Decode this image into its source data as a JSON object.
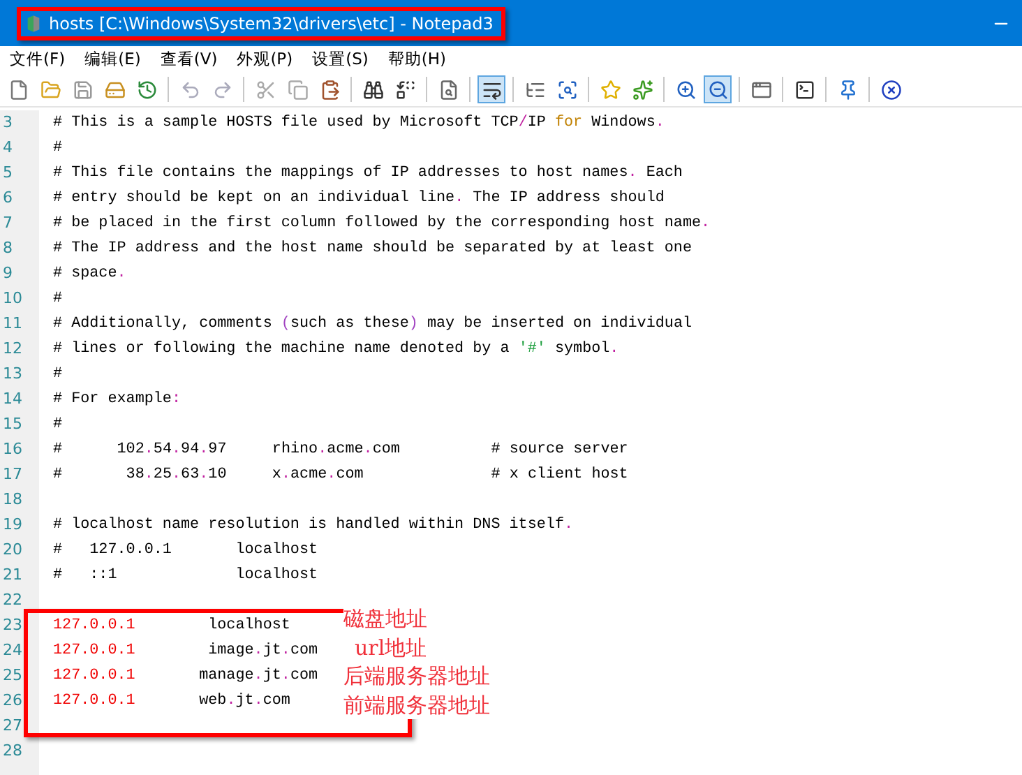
{
  "window": {
    "title": "hosts [C:\\Windows\\System32\\drivers\\etc] - Notepad3"
  },
  "menu": [
    "文件(F)",
    "编辑(E)",
    "查看(V)",
    "外观(P)",
    "设置(S)",
    "帮助(H)"
  ],
  "toolbar": [
    [
      {
        "kind": "new",
        "on": false
      },
      {
        "kind": "open",
        "on": false
      },
      {
        "kind": "save",
        "on": false
      },
      {
        "kind": "saveas",
        "on": false
      },
      {
        "kind": "revert",
        "on": false
      }
    ],
    [
      {
        "kind": "undo",
        "on": false
      },
      {
        "kind": "redo",
        "on": false
      }
    ],
    [
      {
        "kind": "cut",
        "on": false
      },
      {
        "kind": "copy",
        "on": false
      },
      {
        "kind": "paste",
        "on": false
      }
    ],
    [
      {
        "kind": "find",
        "on": false
      },
      {
        "kind": "replace",
        "on": false
      }
    ],
    [
      {
        "kind": "search",
        "on": false
      }
    ],
    [
      {
        "kind": "wrap",
        "on": true
      }
    ],
    [
      {
        "kind": "list",
        "on": false
      },
      {
        "kind": "target",
        "on": false
      }
    ],
    [
      {
        "kind": "star",
        "on": false
      },
      {
        "kind": "staradd",
        "on": false
      }
    ],
    [
      {
        "kind": "zoomin",
        "on": false
      },
      {
        "kind": "zoomout",
        "on": true
      }
    ],
    [
      {
        "kind": "window",
        "on": false
      }
    ],
    [
      {
        "kind": "terminal",
        "on": false
      }
    ],
    [
      {
        "kind": "pin",
        "on": false
      }
    ],
    [
      {
        "kind": "close",
        "on": false
      }
    ]
  ],
  "lines": [
    {
      "number": "3",
      "segments": [
        {
          "text": "# This is a sample HOSTS file used by Microsoft TCP",
          "kind": "plain"
        },
        {
          "text": "/",
          "kind": "punct"
        },
        {
          "text": "IP ",
          "kind": "plain"
        },
        {
          "text": "for",
          "kind": "keyword"
        },
        {
          "text": " Windows",
          "kind": "plain"
        },
        {
          "text": ".",
          "kind": "punct"
        }
      ]
    },
    {
      "number": "4",
      "segments": [
        {
          "text": "#",
          "kind": "plain"
        }
      ]
    },
    {
      "number": "5",
      "segments": [
        {
          "text": "# This file contains the mappings of IP addresses to host names",
          "kind": "plain"
        },
        {
          "text": ".",
          "kind": "punct"
        },
        {
          "text": " Each",
          "kind": "plain"
        }
      ]
    },
    {
      "number": "6",
      "segments": [
        {
          "text": "# entry should be kept on an individual line",
          "kind": "plain"
        },
        {
          "text": ".",
          "kind": "punct"
        },
        {
          "text": " The IP address should",
          "kind": "plain"
        }
      ]
    },
    {
      "number": "7",
      "segments": [
        {
          "text": "# be placed in the first column followed by the corresponding host name",
          "kind": "plain"
        },
        {
          "text": ".",
          "kind": "punct"
        }
      ]
    },
    {
      "number": "8",
      "segments": [
        {
          "text": "# The IP address and the host name should be separated by at least one",
          "kind": "plain"
        }
      ]
    },
    {
      "number": "9",
      "segments": [
        {
          "text": "# space",
          "kind": "plain"
        },
        {
          "text": ".",
          "kind": "punct"
        }
      ]
    },
    {
      "number": "10",
      "segments": [
        {
          "text": "#",
          "kind": "plain"
        }
      ]
    },
    {
      "number": "11",
      "segments": [
        {
          "text": "# Additionally, comments ",
          "kind": "plain"
        },
        {
          "text": "(",
          "kind": "paren"
        },
        {
          "text": "such as these",
          "kind": "plain"
        },
        {
          "text": ")",
          "kind": "paren"
        },
        {
          "text": " may be inserted on individual",
          "kind": "plain"
        }
      ]
    },
    {
      "number": "12",
      "segments": [
        {
          "text": "# lines or following the machine name denoted by a ",
          "kind": "plain"
        },
        {
          "text": "'#'",
          "kind": "string"
        },
        {
          "text": " symbol",
          "kind": "plain"
        },
        {
          "text": ".",
          "kind": "punct"
        }
      ]
    },
    {
      "number": "13",
      "segments": [
        {
          "text": "#",
          "kind": "plain"
        }
      ]
    },
    {
      "number": "14",
      "segments": [
        {
          "text": "# For example",
          "kind": "plain"
        },
        {
          "text": ":",
          "kind": "punct"
        }
      ]
    },
    {
      "number": "15",
      "segments": [
        {
          "text": "#",
          "kind": "plain"
        }
      ]
    },
    {
      "number": "16",
      "segments": [
        {
          "text": "#      102",
          "kind": "plain"
        },
        {
          "text": ".",
          "kind": "punct"
        },
        {
          "text": "54",
          "kind": "plain"
        },
        {
          "text": ".",
          "kind": "punct"
        },
        {
          "text": "94",
          "kind": "plain"
        },
        {
          "text": ".",
          "kind": "punct"
        },
        {
          "text": "97     rhino",
          "kind": "plain"
        },
        {
          "text": ".",
          "kind": "punct"
        },
        {
          "text": "acme",
          "kind": "plain"
        },
        {
          "text": ".",
          "kind": "punct"
        },
        {
          "text": "com          # source server",
          "kind": "plain"
        }
      ]
    },
    {
      "number": "17",
      "segments": [
        {
          "text": "#       38",
          "kind": "plain"
        },
        {
          "text": ".",
          "kind": "punct"
        },
        {
          "text": "25",
          "kind": "plain"
        },
        {
          "text": ".",
          "kind": "punct"
        },
        {
          "text": "63",
          "kind": "plain"
        },
        {
          "text": ".",
          "kind": "punct"
        },
        {
          "text": "10     x",
          "kind": "plain"
        },
        {
          "text": ".",
          "kind": "punct"
        },
        {
          "text": "acme",
          "kind": "plain"
        },
        {
          "text": ".",
          "kind": "punct"
        },
        {
          "text": "com              # x client host",
          "kind": "plain"
        }
      ]
    },
    {
      "number": "18"
    },
    {
      "number": "19",
      "segments": [
        {
          "text": "# localhost name resolution is handled within DNS itself",
          "kind": "plain"
        },
        {
          "text": ".",
          "kind": "punct"
        }
      ]
    },
    {
      "number": "20",
      "segments": [
        {
          "text": "#   127.0.0.1       localhost",
          "kind": "plain"
        }
      ]
    },
    {
      "number": "21",
      "segments": [
        {
          "text": "#   ::1             localhost",
          "kind": "plain"
        }
      ]
    },
    {
      "number": "22"
    },
    {
      "number": "23",
      "segments": [
        {
          "text": "127.0.0.1",
          "kind": "address"
        },
        {
          "text": "        localhost",
          "kind": "plain"
        }
      ]
    },
    {
      "number": "24",
      "segments": [
        {
          "text": "127.0.0.1",
          "kind": "address"
        },
        {
          "text": "        image",
          "kind": "plain"
        },
        {
          "text": ".",
          "kind": "punct"
        },
        {
          "text": "jt",
          "kind": "plain"
        },
        {
          "text": ".",
          "kind": "punct"
        },
        {
          "text": "com",
          "kind": "plain"
        }
      ]
    },
    {
      "number": "25",
      "segments": [
        {
          "text": "127.0.0.1",
          "kind": "address"
        },
        {
          "text": "       manage",
          "kind": "plain"
        },
        {
          "text": ".",
          "kind": "punct"
        },
        {
          "text": "jt",
          "kind": "plain"
        },
        {
          "text": ".",
          "kind": "punct"
        },
        {
          "text": "com",
          "kind": "plain"
        }
      ]
    },
    {
      "number": "26",
      "segments": [
        {
          "text": "127.0.0.1",
          "kind": "address"
        },
        {
          "text": "       web",
          "kind": "plain"
        },
        {
          "text": ".",
          "kind": "punct"
        },
        {
          "text": "jt",
          "kind": "plain"
        },
        {
          "text": ".",
          "kind": "punct"
        },
        {
          "text": "com",
          "kind": "plain"
        }
      ]
    },
    {
      "number": "27"
    },
    {
      "number": "28"
    }
  ],
  "annotations": [
    "磁盘地址",
    "url地址",
    "后端服务器地址",
    "前端服务器地址"
  ]
}
